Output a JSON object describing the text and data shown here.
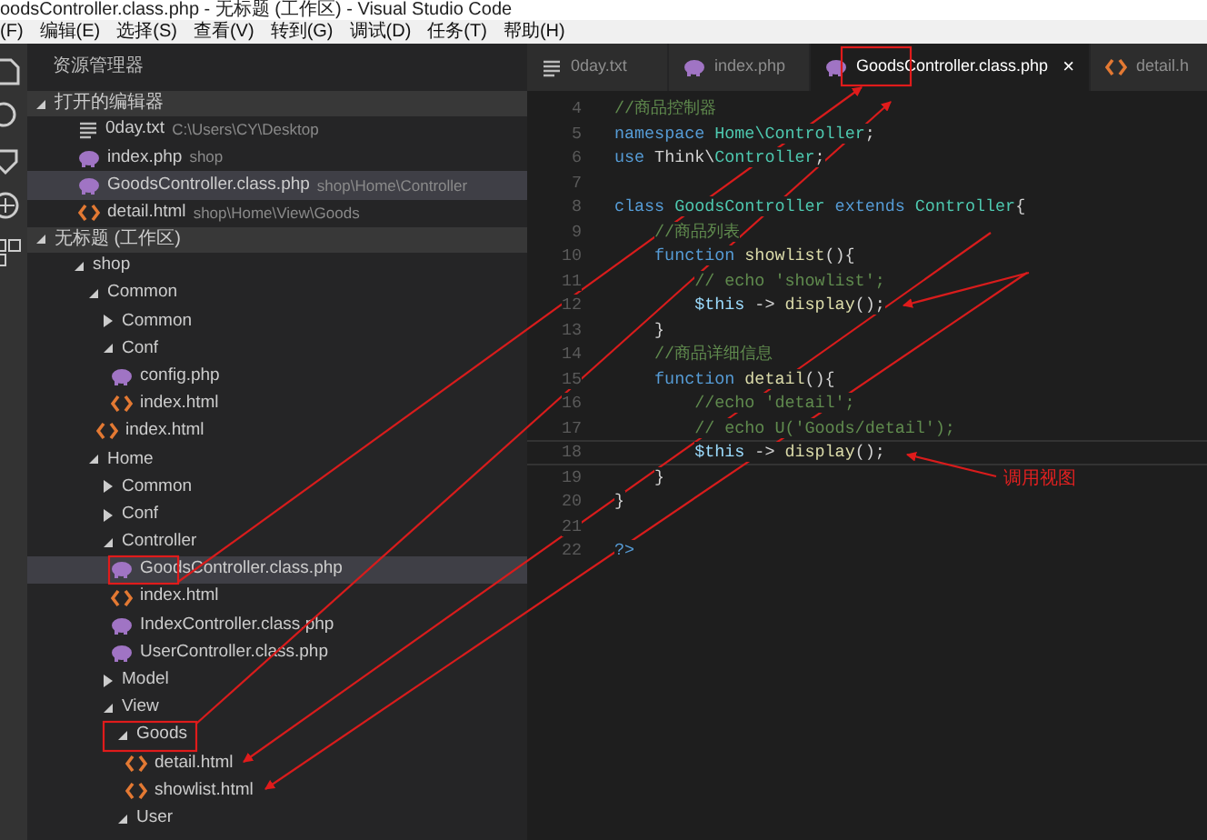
{
  "window": {
    "title": "oodsController.class.php - 无标题 (工作区) - Visual Studio Code"
  },
  "menu": [
    "(F)",
    "编辑(E)",
    "选择(S)",
    "查看(V)",
    "转到(G)",
    "调试(D)",
    "任务(T)",
    "帮助(H)"
  ],
  "sidebar": {
    "title": "资源管理器",
    "open_editors": {
      "title": "打开的编辑器",
      "expanded": true,
      "items": [
        {
          "kind": "txt",
          "name": "0day.txt",
          "path": "C:\\Users\\CY\\Desktop",
          "selected": false
        },
        {
          "kind": "php",
          "name": "index.php",
          "path": "shop",
          "selected": false
        },
        {
          "kind": "php",
          "name": "GoodsController.class.php",
          "path": "shop\\Home\\Controller",
          "selected": true
        },
        {
          "kind": "html",
          "name": "detail.html",
          "path": "shop\\Home\\View\\Goods",
          "selected": false
        }
      ]
    },
    "workspace": {
      "title": "无标题 (工作区)",
      "expanded": true,
      "tree": [
        {
          "kind": "folder",
          "name": "shop",
          "expanded": true,
          "selected": false,
          "children": [
            {
              "kind": "folder",
              "name": "Common",
              "expanded": true,
              "selected": false,
              "children": [
                {
                  "kind": "folder",
                  "name": "Common",
                  "expanded": false,
                  "selected": false
                },
                {
                  "kind": "folder",
                  "name": "Conf",
                  "expanded": true,
                  "selected": false,
                  "children": [
                    {
                      "kind": "php",
                      "name": "config.php",
                      "selected": false
                    },
                    {
                      "kind": "html",
                      "name": "index.html",
                      "selected": false
                    }
                  ]
                },
                {
                  "kind": "html",
                  "name": "index.html",
                  "selected": false
                }
              ]
            },
            {
              "kind": "folder",
              "name": "Home",
              "expanded": true,
              "selected": false,
              "children": [
                {
                  "kind": "folder",
                  "name": "Common",
                  "expanded": false,
                  "selected": false
                },
                {
                  "kind": "folder",
                  "name": "Conf",
                  "expanded": false,
                  "selected": false
                },
                {
                  "kind": "folder",
                  "name": "Controller",
                  "expanded": true,
                  "selected": false,
                  "children": [
                    {
                      "kind": "php",
                      "name": "GoodsController.class.php",
                      "selected": true
                    },
                    {
                      "kind": "html",
                      "name": "index.html",
                      "selected": false
                    },
                    {
                      "kind": "php",
                      "name": "IndexController.class.php",
                      "selected": false
                    },
                    {
                      "kind": "php",
                      "name": "UserController.class.php",
                      "selected": false
                    }
                  ]
                },
                {
                  "kind": "folder",
                  "name": "Model",
                  "expanded": false,
                  "selected": false
                },
                {
                  "kind": "folder",
                  "name": "View",
                  "expanded": true,
                  "selected": false,
                  "children": [
                    {
                      "kind": "folder",
                      "name": "Goods",
                      "expanded": true,
                      "selected": false,
                      "children": [
                        {
                          "kind": "html",
                          "name": "detail.html",
                          "selected": false
                        },
                        {
                          "kind": "html",
                          "name": "showlist.html",
                          "selected": false
                        }
                      ]
                    },
                    {
                      "kind": "folder",
                      "name": "User",
                      "expanded": true,
                      "selected": false
                    }
                  ]
                }
              ]
            }
          ]
        }
      ]
    }
  },
  "tabs": [
    {
      "kind": "txt",
      "label": "0day.txt",
      "selected": false
    },
    {
      "kind": "php",
      "label": "index.php",
      "selected": false
    },
    {
      "kind": "php",
      "label": "GoodsController.class.php",
      "selected": true,
      "close": "×"
    },
    {
      "kind": "html",
      "label": "detail.h",
      "selected": false
    }
  ],
  "editor": {
    "lines": [
      {
        "number": "4",
        "current": false,
        "tokens": [
          {
            "kind": "comment",
            "text": "//商品控制器"
          }
        ]
      },
      {
        "number": "5",
        "current": false,
        "tokens": [
          {
            "kind": "keyword",
            "text": "namespace"
          },
          {
            "kind": "type",
            "text": " Home\\Controller"
          },
          {
            "kind": "plain",
            "text": ";"
          }
        ]
      },
      {
        "number": "6",
        "current": false,
        "tokens": [
          {
            "kind": "keyword",
            "text": "use"
          },
          {
            "kind": "plain",
            "text": " Think\\"
          },
          {
            "kind": "type",
            "text": "Controller"
          },
          {
            "kind": "plain",
            "text": ";"
          }
        ]
      },
      {
        "number": "7",
        "current": false
      },
      {
        "number": "8",
        "current": false,
        "tokens": [
          {
            "kind": "keyword",
            "text": "class"
          },
          {
            "kind": "type",
            "text": " GoodsController"
          },
          {
            "kind": "keyword",
            "text": " extends"
          },
          {
            "kind": "type",
            "text": " Controller"
          },
          {
            "kind": "plain",
            "text": "{"
          }
        ],
        "children": [
          {
            "number": "9",
            "current": false,
            "tokens": [
              {
                "kind": "comment",
                "text": "//商品列表"
              }
            ]
          },
          {
            "number": "10",
            "current": false,
            "tokens": [
              {
                "kind": "keyword",
                "text": "function"
              },
              {
                "kind": "function",
                "text": " showlist"
              },
              {
                "kind": "plain",
                "text": "(){"
              }
            ],
            "children": [
              {
                "number": "11",
                "current": false,
                "tokens": [
                  {
                    "kind": "comment",
                    "text": "// echo 'showlist';"
                  }
                ]
              },
              {
                "number": "12",
                "current": false,
                "tokens": [
                  {
                    "kind": "variable",
                    "text": "$this"
                  },
                  {
                    "kind": "plain",
                    "text": " -> "
                  },
                  {
                    "kind": "function",
                    "text": "display"
                  },
                  {
                    "kind": "plain",
                    "text": "();"
                  }
                ]
              }
            ]
          },
          {
            "number": "13",
            "current": false,
            "tokens": [
              {
                "kind": "plain",
                "text": "}"
              }
            ]
          },
          {
            "number": "14",
            "current": false,
            "tokens": [
              {
                "kind": "comment",
                "text": "//商品详细信息"
              }
            ]
          },
          {
            "number": "15",
            "current": false,
            "tokens": [
              {
                "kind": "keyword",
                "text": "function"
              },
              {
                "kind": "function",
                "text": " detail"
              },
              {
                "kind": "plain",
                "text": "(){"
              }
            ],
            "children": [
              {
                "number": "16",
                "current": false,
                "tokens": [
                  {
                    "kind": "comment",
                    "text": "//echo 'detail';"
                  }
                ]
              },
              {
                "number": "17",
                "current": false,
                "tokens": [
                  {
                    "kind": "comment",
                    "text": "// echo U('Goods/detail');"
                  }
                ]
              },
              {
                "number": "18",
                "current": true,
                "tokens": [
                  {
                    "kind": "variable",
                    "text": "$this"
                  },
                  {
                    "kind": "plain",
                    "text": " -> "
                  },
                  {
                    "kind": "function",
                    "text": "display"
                  },
                  {
                    "kind": "plain",
                    "text": "();"
                  }
                ]
              }
            ]
          },
          {
            "number": "19",
            "current": false,
            "tokens": [
              {
                "kind": "plain",
                "text": "}"
              }
            ]
          }
        ]
      },
      {
        "number": "20",
        "current": false,
        "tokens": [
          {
            "kind": "plain",
            "text": "}"
          }
        ]
      },
      {
        "number": "21",
        "current": false
      },
      {
        "number": "22",
        "current": false,
        "tokens": [
          {
            "kind": "keyword",
            "text": "?>"
          }
        ]
      }
    ]
  },
  "annotation": {
    "label": "调用视图"
  }
}
